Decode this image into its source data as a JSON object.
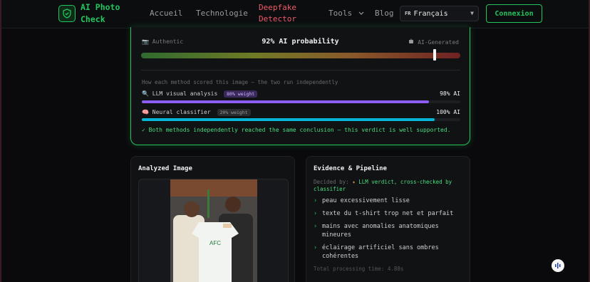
{
  "header": {
    "logo_line1": "AI Photo",
    "logo_line2": "Check",
    "nav": {
      "home": "Accueil",
      "technology": "Technologie",
      "deepfake_line1": "Deepfake",
      "deepfake_line2": "Detector",
      "tools": "Tools",
      "blog": "Blog"
    },
    "language": {
      "flag": "FR",
      "selected": "Français"
    },
    "login_label": "Connexion"
  },
  "probability": {
    "left_label": "Authentic",
    "right_label": "AI-Generated",
    "title": "92% AI probability",
    "value_percent": 92,
    "methods_intro": "How each method scored this image — the two run independently",
    "methods": [
      {
        "name": "LLM visual analysis",
        "weight": "80% weight",
        "score": "98% AI",
        "score_value": 98,
        "color": "#8b5cf6"
      },
      {
        "name": "Neural classifier",
        "weight": "20% weight",
        "score": "100% AI",
        "score_value": 100,
        "color": "#06b6d4"
      }
    ],
    "verdict": "✓ Both methods independently reached the same conclusion — this verdict is well supported."
  },
  "analyzed_image": {
    "title": "Analyzed Image",
    "jersey_text": "AFC"
  },
  "evidence": {
    "title": "Evidence & Pipeline",
    "decided_prefix": "Decided by:",
    "decided_value": "LLM verdict, cross-checked by classifier",
    "items": [
      "peau excessivement lisse",
      "texte du t-shirt trop net et parfait",
      "mains avec anomalies anatomiques mineures",
      "éclairage artificiel sans ombres cohérentes"
    ],
    "processing_time": "Total processing time: 4.88s"
  },
  "colors": {
    "accent": "#22c55e",
    "danger": "#f05a6a",
    "background": "#0a0a0c"
  }
}
